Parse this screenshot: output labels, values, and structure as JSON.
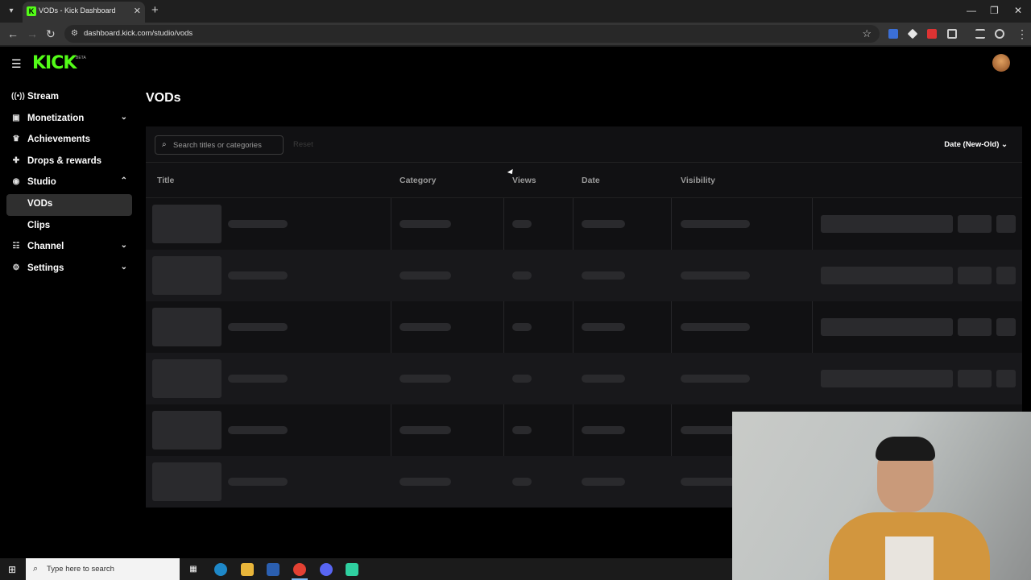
{
  "browser": {
    "tab_title": "VODs - Kick Dashboard",
    "url": "dashboard.kick.com/studio/vods",
    "new_tab": "+",
    "close_tab": "✕"
  },
  "app": {
    "logo": "KICK",
    "logo_badge": "BETA"
  },
  "sidebar": {
    "items": [
      {
        "label": "Stream",
        "icon": "broadcast-icon"
      },
      {
        "label": "Monetization",
        "icon": "monetization-icon"
      },
      {
        "label": "Achievements",
        "icon": "trophy-icon"
      },
      {
        "label": "Drops & rewards",
        "icon": "gift-icon"
      },
      {
        "label": "Studio",
        "icon": "studio-icon"
      },
      {
        "label": "VODs"
      },
      {
        "label": "Clips"
      },
      {
        "label": "Channel",
        "icon": "channel-icon"
      },
      {
        "label": "Settings",
        "icon": "gear-icon"
      }
    ]
  },
  "main": {
    "title": "VODs",
    "search_placeholder": "Search titles or categories",
    "reset_label": "Reset",
    "sort_label": "Date (New-Old)",
    "columns": [
      "Title",
      "Category",
      "Views",
      "Date",
      "Visibility"
    ]
  },
  "taskbar": {
    "search_placeholder": "Type here to search"
  }
}
